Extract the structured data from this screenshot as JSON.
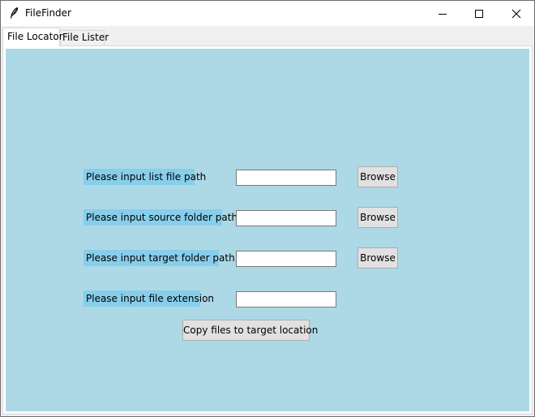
{
  "window": {
    "title": "FileFinder"
  },
  "tabs": [
    {
      "label": "File Locator",
      "active": true
    },
    {
      "label": "File Lister",
      "active": false
    }
  ],
  "form": {
    "rows": [
      {
        "label": "Please input list file path",
        "value": "",
        "browse_label": "Browse"
      },
      {
        "label": "Please input source folder path",
        "value": "",
        "browse_label": "Browse"
      },
      {
        "label": "Please input target folder path",
        "value": "",
        "browse_label": "Browse"
      },
      {
        "label": "Please input file extension",
        "value": ""
      }
    ],
    "copy_button_label": "Copy files to target location"
  },
  "colors": {
    "panel_background": "#add8e6",
    "label_background": "#87ceeb"
  },
  "icons": {
    "app": "feather-icon",
    "minimize": "minimize-icon",
    "maximize": "maximize-icon",
    "close": "close-icon"
  }
}
